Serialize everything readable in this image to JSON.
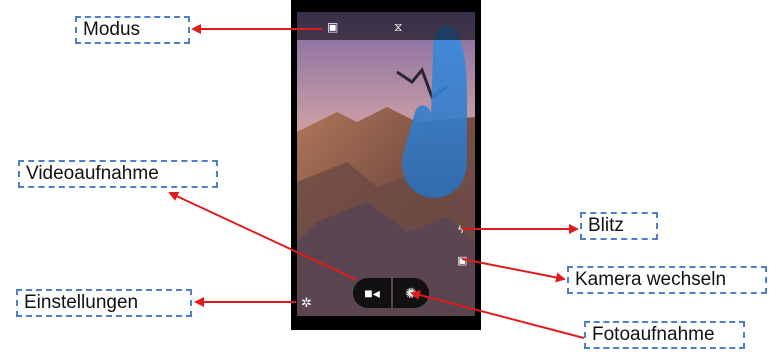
{
  "labels": {
    "modus": "Modus",
    "videoaufnahme": "Videoaufnahme",
    "einstellungen": "Einstellungen",
    "blitz": "Blitz",
    "kamera_wechseln": "Kamera wechseln",
    "fotoaufnahme": "Fotoaufnahme"
  },
  "colors": {
    "arrow": "#e01b1b",
    "label_border": "#4f7fc6"
  },
  "icons": {
    "mode_photo": "camera-mode-icon",
    "mode_panorama": "panorama-mode-icon",
    "video": "video-camera-icon",
    "shutter": "shutter-icon",
    "settings": "gear-icon",
    "flash": "flash-icon",
    "switch_camera": "switch-camera-icon"
  }
}
